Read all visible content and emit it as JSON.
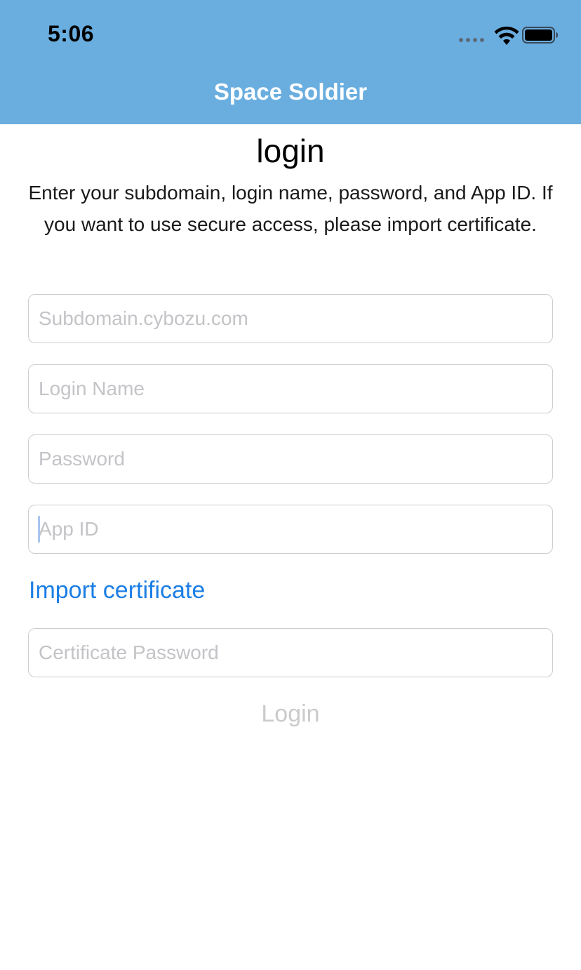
{
  "status_bar": {
    "time": "5:06"
  },
  "nav": {
    "title": "Space Soldier"
  },
  "heading": "login",
  "instructions": "Enter your subdomain, login name, password, and App ID. If you want to use secure access, please import certificate.",
  "form": {
    "subdomain": {
      "placeholder": "Subdomain.cybozu.com",
      "value": ""
    },
    "login_name": {
      "placeholder": "Login Name",
      "value": ""
    },
    "password": {
      "placeholder": "Password",
      "value": ""
    },
    "app_id": {
      "placeholder": "App ID",
      "value": ""
    },
    "import_certificate_label": "Import certificate",
    "certificate_password": {
      "placeholder": "Certificate Password",
      "value": ""
    },
    "login_label": "Login"
  },
  "colors": {
    "nav_background": "#6aaee0",
    "link": "#1b7ee5",
    "disabled_text": "#cbcbcd",
    "placeholder": "#c4c4c8",
    "field_border": "#cdcdcd"
  },
  "icons": [
    "cellular-signal-icon",
    "wifi-icon",
    "battery-icon"
  ]
}
